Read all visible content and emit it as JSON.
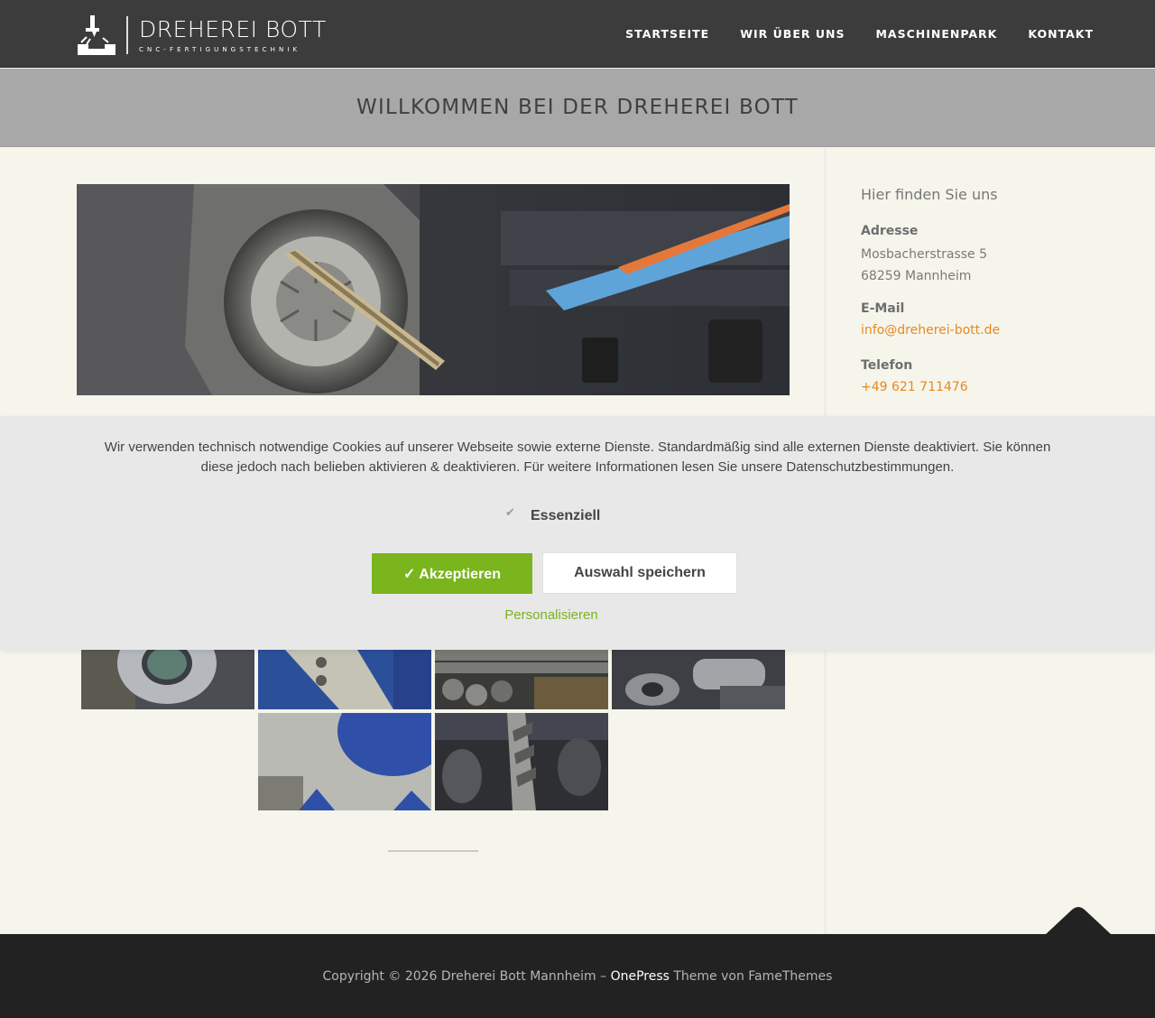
{
  "header": {
    "logo_title": "DREHEREI BOTT",
    "logo_subtitle": "CNC-FERTIGUNGSTECHNIK",
    "nav": [
      {
        "label": "STARTSEITE"
      },
      {
        "label": "WIR ÜBER UNS"
      },
      {
        "label": "MASCHINENPARK"
      },
      {
        "label": "KONTAKT"
      }
    ]
  },
  "page": {
    "title": "WILLKOMMEN BEI DER DREHEREI BOTT"
  },
  "sidebar": {
    "heading": "Hier finden Sie uns",
    "address_label": "Adresse",
    "address_line1": "Mosbacherstrasse 5",
    "address_line2": "68259 Mannheim",
    "email_label": "E-Mail",
    "email": "info@dreherei-bott.de",
    "phone_label": "Telefon",
    "phone": "+49 621 711476"
  },
  "cookie": {
    "text": "Wir verwenden technisch notwendige Cookies auf unserer Webseite sowie externe Dienste. Standardmäßig sind alle externen Dienste deaktiviert. Sie können diese jedoch nach belieben aktivieren & deaktivieren. Für weitere Informationen lesen Sie unsere Datenschutzbestimmungen.",
    "essential_label": "Essenziell",
    "accept_label": "✓ Akzeptieren",
    "save_label": "Auswahl speichern",
    "personalize_label": "Personalisieren"
  },
  "footer": {
    "prefix": "Copyright © 2026 Dreherei Bott Mannheim – ",
    "theme_link": "OnePress",
    "suffix": " Theme von FameThemes"
  },
  "colors": {
    "accent_orange": "#e8891c",
    "accept_green": "#7ab51d",
    "header_bg": "#3c3c3c",
    "footer_bg": "#222222"
  }
}
